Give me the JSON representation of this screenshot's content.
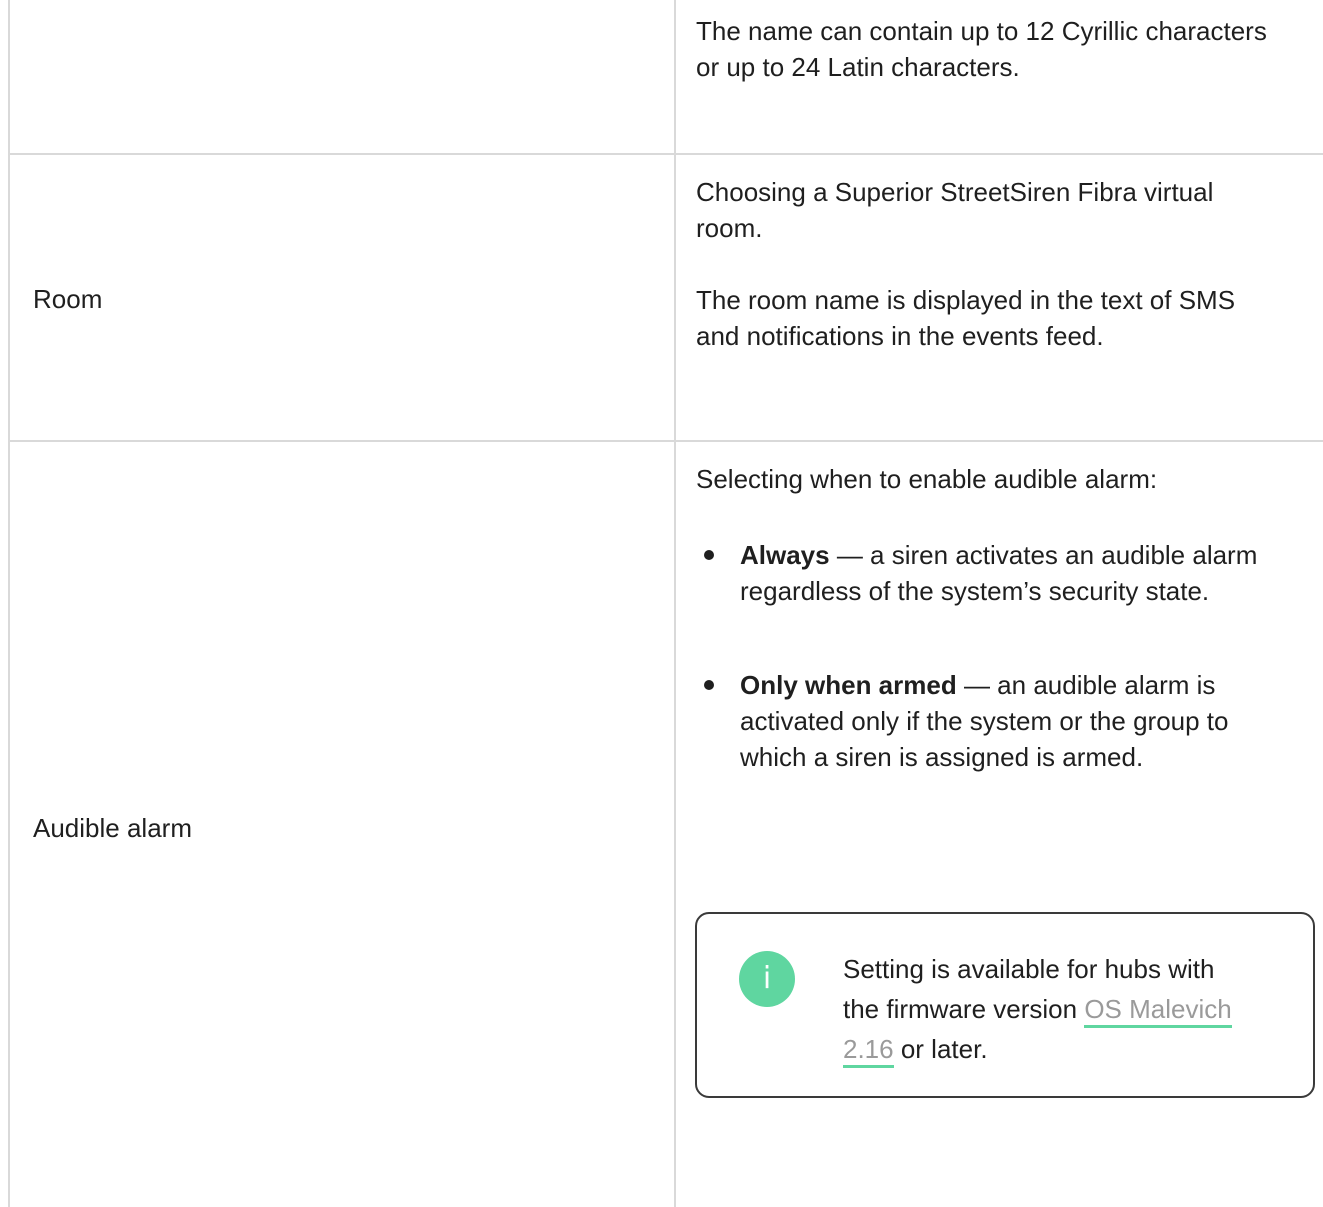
{
  "rows": {
    "name": {
      "description": [
        "The name can contain up to 12 Cyrillic characters",
        "or up to 24 Latin characters."
      ]
    },
    "room": {
      "label": "Room",
      "description_1": [
        "Choosing a Superior StreetSiren Fibra virtual",
        "room."
      ],
      "description_2": [
        "The room name is displayed in the text of SMS",
        "and notifications in the events feed."
      ]
    },
    "audible_alarm": {
      "label": "Audible alarm",
      "intro": "Selecting when to enable audible alarm:",
      "options": [
        {
          "term": "Always",
          "lines": [
            " — a siren activates an audible alarm",
            "regardless of the system’s security state."
          ]
        },
        {
          "term": "Only when armed",
          "lines": [
            " — an audible alarm is",
            "activated only if the system or the group to",
            "which a siren is assigned is armed."
          ]
        }
      ],
      "note": {
        "icon": "info-icon",
        "icon_glyph": "i",
        "accent_color": "#5fd6a0",
        "text_before": "Setting is available for hubs with",
        "text_before_2": "the firmware version ",
        "link_text_1": "OS Malevich",
        "link_text_2": "2.16",
        "text_after": " or later."
      }
    }
  }
}
